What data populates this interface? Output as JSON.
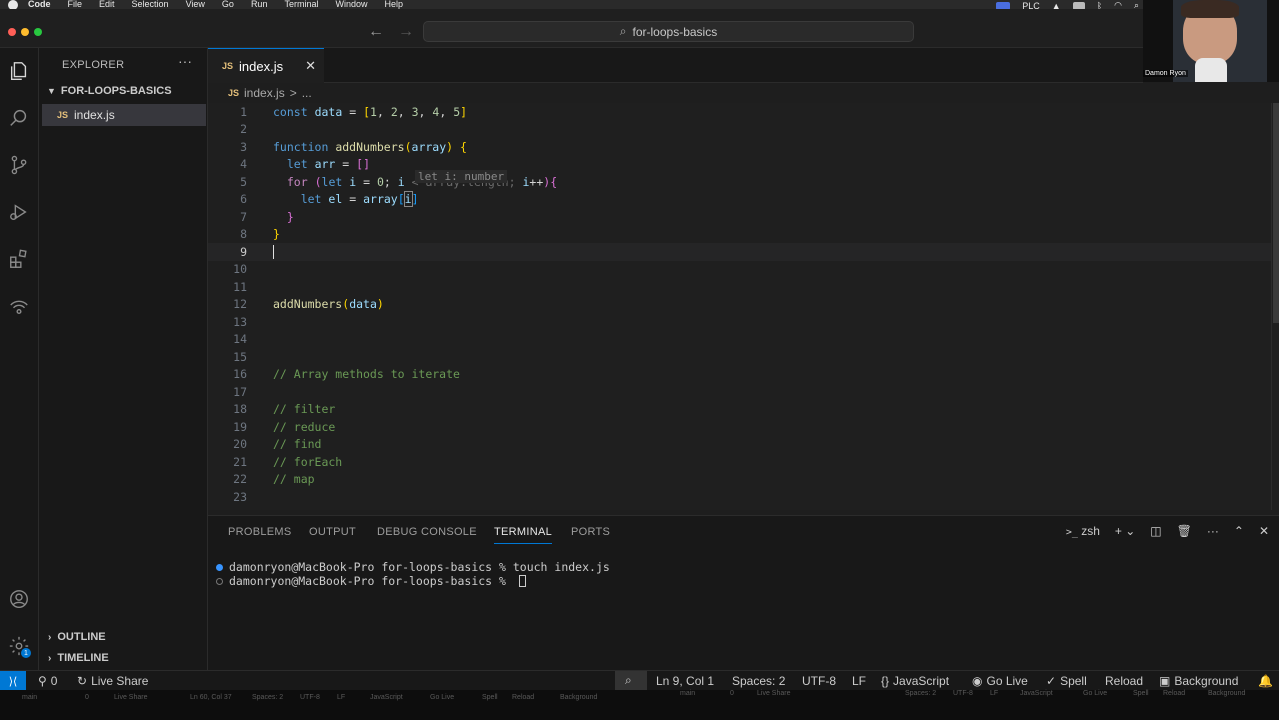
{
  "menubar": {
    "items": [
      "Code",
      "File",
      "Edit",
      "Selection",
      "View",
      "Go",
      "Run",
      "Terminal",
      "Window",
      "Help"
    ],
    "tray_label": "PLC"
  },
  "titlebar": {
    "command_center": "for-loops-basics"
  },
  "webcam": {
    "name": "Damon Ryon"
  },
  "sidebar": {
    "title": "EXPLORER",
    "more": "···",
    "folder": "FOR-LOOPS-BASICS",
    "file": "index.js",
    "file_icon": "JS",
    "outline": "OUTLINE",
    "timeline": "TIMELINE"
  },
  "tab": {
    "icon": "JS",
    "label": "index.js",
    "close": "✕"
  },
  "breadcrumb": {
    "icon": "JS",
    "file": "index.js",
    "sep": ">",
    "rest": "..."
  },
  "editor": {
    "line_numbers": [
      "1",
      "2",
      "3",
      "4",
      "5",
      "6",
      "7",
      "8",
      "9",
      "10",
      "11",
      "12",
      "13",
      "14",
      "15",
      "16",
      "17",
      "18",
      "19",
      "20",
      "21",
      "22",
      "23"
    ],
    "active_line": 9,
    "hint": "let i: number",
    "comments": {
      "l16": "// Array methods to iterate",
      "l18": "// filter",
      "l19": "// reduce",
      "l20": "// find",
      "l21": "// forEach",
      "l22": "// map"
    }
  },
  "panel": {
    "tabs": [
      "PROBLEMS",
      "OUTPUT",
      "DEBUG CONSOLE",
      "TERMINAL",
      "PORTS"
    ],
    "active_tab": "TERMINAL",
    "shell": "zsh",
    "terminal_lines": [
      "damonryon@MacBook-Pro for-loops-basics % touch index.js",
      "damonryon@MacBook-Pro for-loops-basics % "
    ]
  },
  "statusbar": {
    "problems": "0",
    "live_share": "Live Share",
    "position": "Ln 9, Col 1",
    "spaces": "Spaces: 2",
    "encoding": "UTF-8",
    "eol": "LF",
    "language": "JavaScript",
    "go_live": "Go Live",
    "spell": "Spell",
    "reload": "Reload",
    "background": "Background"
  },
  "ghost_strip": {
    "left": [
      "main",
      "0",
      "Live Share",
      "Ln 60, Col 37",
      "Spaces: 2",
      "UTF-8",
      "LF",
      "JavaScript",
      "Go Live",
      "Spell",
      "Reload",
      "Background"
    ],
    "right": [
      "main",
      "0",
      "Live Share",
      "Spaces: 2",
      "UTF-8",
      "LF",
      "JavaScript",
      "Go Live",
      "Spell",
      "Reload",
      "Background"
    ]
  },
  "colors": {
    "accent": "#0078d4",
    "editor_bg": "#1f1f1f",
    "sidebar_bg": "#181818"
  }
}
